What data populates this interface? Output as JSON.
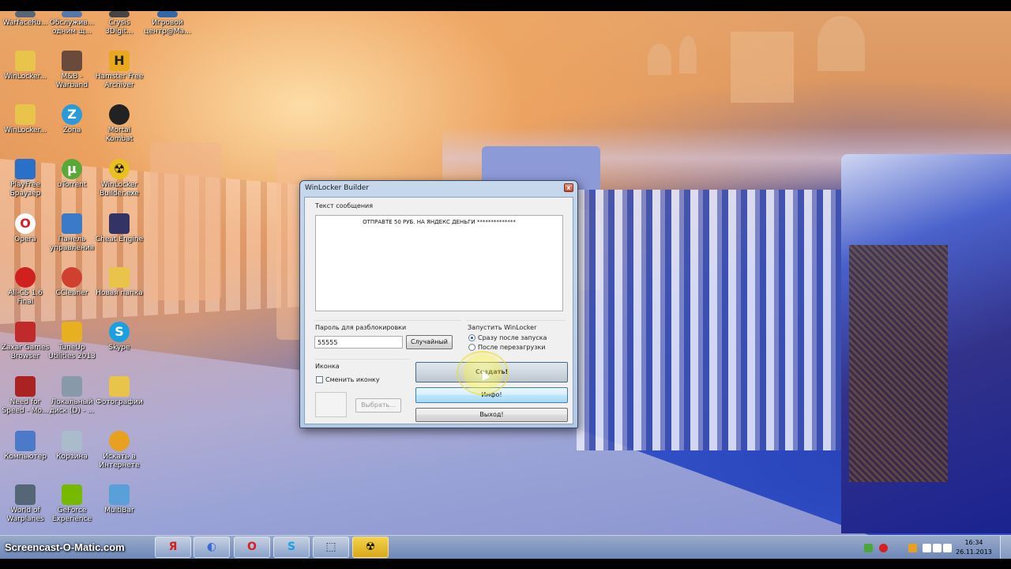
{
  "desktop_icons": [
    {
      "id": "warface",
      "label": "WarfaceRu...",
      "glyph": "",
      "color": "#556677"
    },
    {
      "id": "obsluzh",
      "label": "Обслужив... одним щ...",
      "glyph": "",
      "color": "#5577aa"
    },
    {
      "id": "crysis",
      "label": "Crysis 3Digit...",
      "glyph": "",
      "color": "#444444"
    },
    {
      "id": "igrovoy",
      "label": "Игровой центр@Ma...",
      "glyph": "",
      "color": "#3366aa"
    },
    {
      "id": "winlocker1",
      "label": "WinLocker...",
      "glyph": "",
      "color": "#e8c44a"
    },
    {
      "id": "mb",
      "label": "M&B - Warband",
      "glyph": "",
      "color": "#6a4a3a"
    },
    {
      "id": "hamster",
      "label": "Hamster Free Archiver",
      "glyph": "H",
      "color": "#e8a820"
    },
    {
      "id": "winlocker2",
      "label": "WinLocker...",
      "glyph": "",
      "color": "#e8c44a"
    },
    {
      "id": "zona",
      "label": "Zona",
      "glyph": "Z",
      "color": "#2a9ad8"
    },
    {
      "id": "mortal",
      "label": "Mortal Kombat",
      "glyph": "",
      "color": "#222222"
    },
    {
      "id": "playfree",
      "label": "PlayFree Браузер",
      "glyph": "",
      "color": "#2a70c8"
    },
    {
      "id": "utorrent",
      "label": "uTorrent",
      "glyph": "µ",
      "color": "#5aa83a"
    },
    {
      "id": "winlockerbuilder",
      "label": "WinLocker Builder.exe",
      "glyph": "☢",
      "color": "#e8c020"
    },
    {
      "id": "opera",
      "label": "Opera",
      "glyph": "O",
      "color": "#d4202a"
    },
    {
      "id": "panel",
      "label": "Панель управления",
      "glyph": "",
      "color": "#3a7ac8"
    },
    {
      "id": "cheatengine",
      "label": "Cheat Engine",
      "glyph": "",
      "color": "#333366"
    },
    {
      "id": "allcs",
      "label": "All-CS 1.6 Final",
      "glyph": "",
      "color": "#d02020"
    },
    {
      "id": "ccleaner",
      "label": "CCleaner",
      "glyph": "",
      "color": "#d04030"
    },
    {
      "id": "novaya",
      "label": "Новая папка",
      "glyph": "",
      "color": "#e8c44a"
    },
    {
      "id": "zaxar",
      "label": "Zaxar Games Browser",
      "glyph": "",
      "color": "#c02a2a"
    },
    {
      "id": "tuneup",
      "label": "TuneUp Utilities 2013",
      "glyph": "",
      "color": "#e8b020"
    },
    {
      "id": "skype1",
      "label": "Skype",
      "glyph": "S",
      "color": "#1aa0e0"
    },
    {
      "id": "nfs",
      "label": "Need for Speed - Mo...",
      "glyph": "",
      "color": "#aa2222"
    },
    {
      "id": "localdisk",
      "label": "Локальный диск (D) - ...",
      "glyph": "",
      "color": "#8899aa"
    },
    {
      "id": "photos",
      "label": "Фотографии",
      "glyph": "",
      "color": "#e8c44a"
    },
    {
      "id": "computer",
      "label": "Компьютер",
      "glyph": "",
      "color": "#4a7ac8"
    },
    {
      "id": "recycle",
      "label": "Корзина",
      "glyph": "",
      "color": "#aabbcc"
    },
    {
      "id": "search",
      "label": "Искать в Интернете",
      "glyph": "",
      "color": "#e8a020"
    },
    {
      "id": "wow",
      "label": "World of Warplanes",
      "glyph": "",
      "color": "#556677"
    },
    {
      "id": "geforce",
      "label": "GeForce Experience",
      "glyph": "",
      "color": "#76b900"
    },
    {
      "id": "multibar",
      "label": "MultiBar",
      "glyph": "",
      "color": "#5aa0d8"
    }
  ],
  "dialog": {
    "title": "WinLocker Builder",
    "close_glyph": "x",
    "message_label": "Текст сообщения",
    "message_text": "ОТПРАВТЕ 50 РУБ. НА ЯНДЕКС ДЕНЬГИ **************",
    "password_label": "Пароль для разблокировки",
    "password_value": "55555",
    "random_button": "Случайный",
    "launch_label": "Запустить WinLocker",
    "radio_immediately": "Сразу после запуска",
    "radio_reboot": "После перезагрузки",
    "icon_label": "Иконка",
    "change_icon_label": "Сменить иконку",
    "browse_button": "Выбрать...",
    "create_button": "Создать!",
    "info_button": "Инфо!",
    "exit_button": "Выход!"
  },
  "taskbar": {
    "watermark": "Screencast-O-Matic.com",
    "pinned": [
      {
        "id": "yandex",
        "glyph": "Я",
        "color": "#d42020"
      },
      {
        "id": "media",
        "glyph": "◐",
        "color": "#3a6ad0"
      },
      {
        "id": "opera",
        "glyph": "O",
        "color": "#d42020"
      },
      {
        "id": "skype",
        "glyph": "S",
        "color": "#1aa0e0"
      },
      {
        "id": "screencast",
        "glyph": "⬚",
        "color": "#333333"
      },
      {
        "id": "winlocker",
        "glyph": "☢",
        "color": "#e8c020"
      }
    ],
    "clock_time": "16:34",
    "clock_date": "26.11.2013"
  }
}
